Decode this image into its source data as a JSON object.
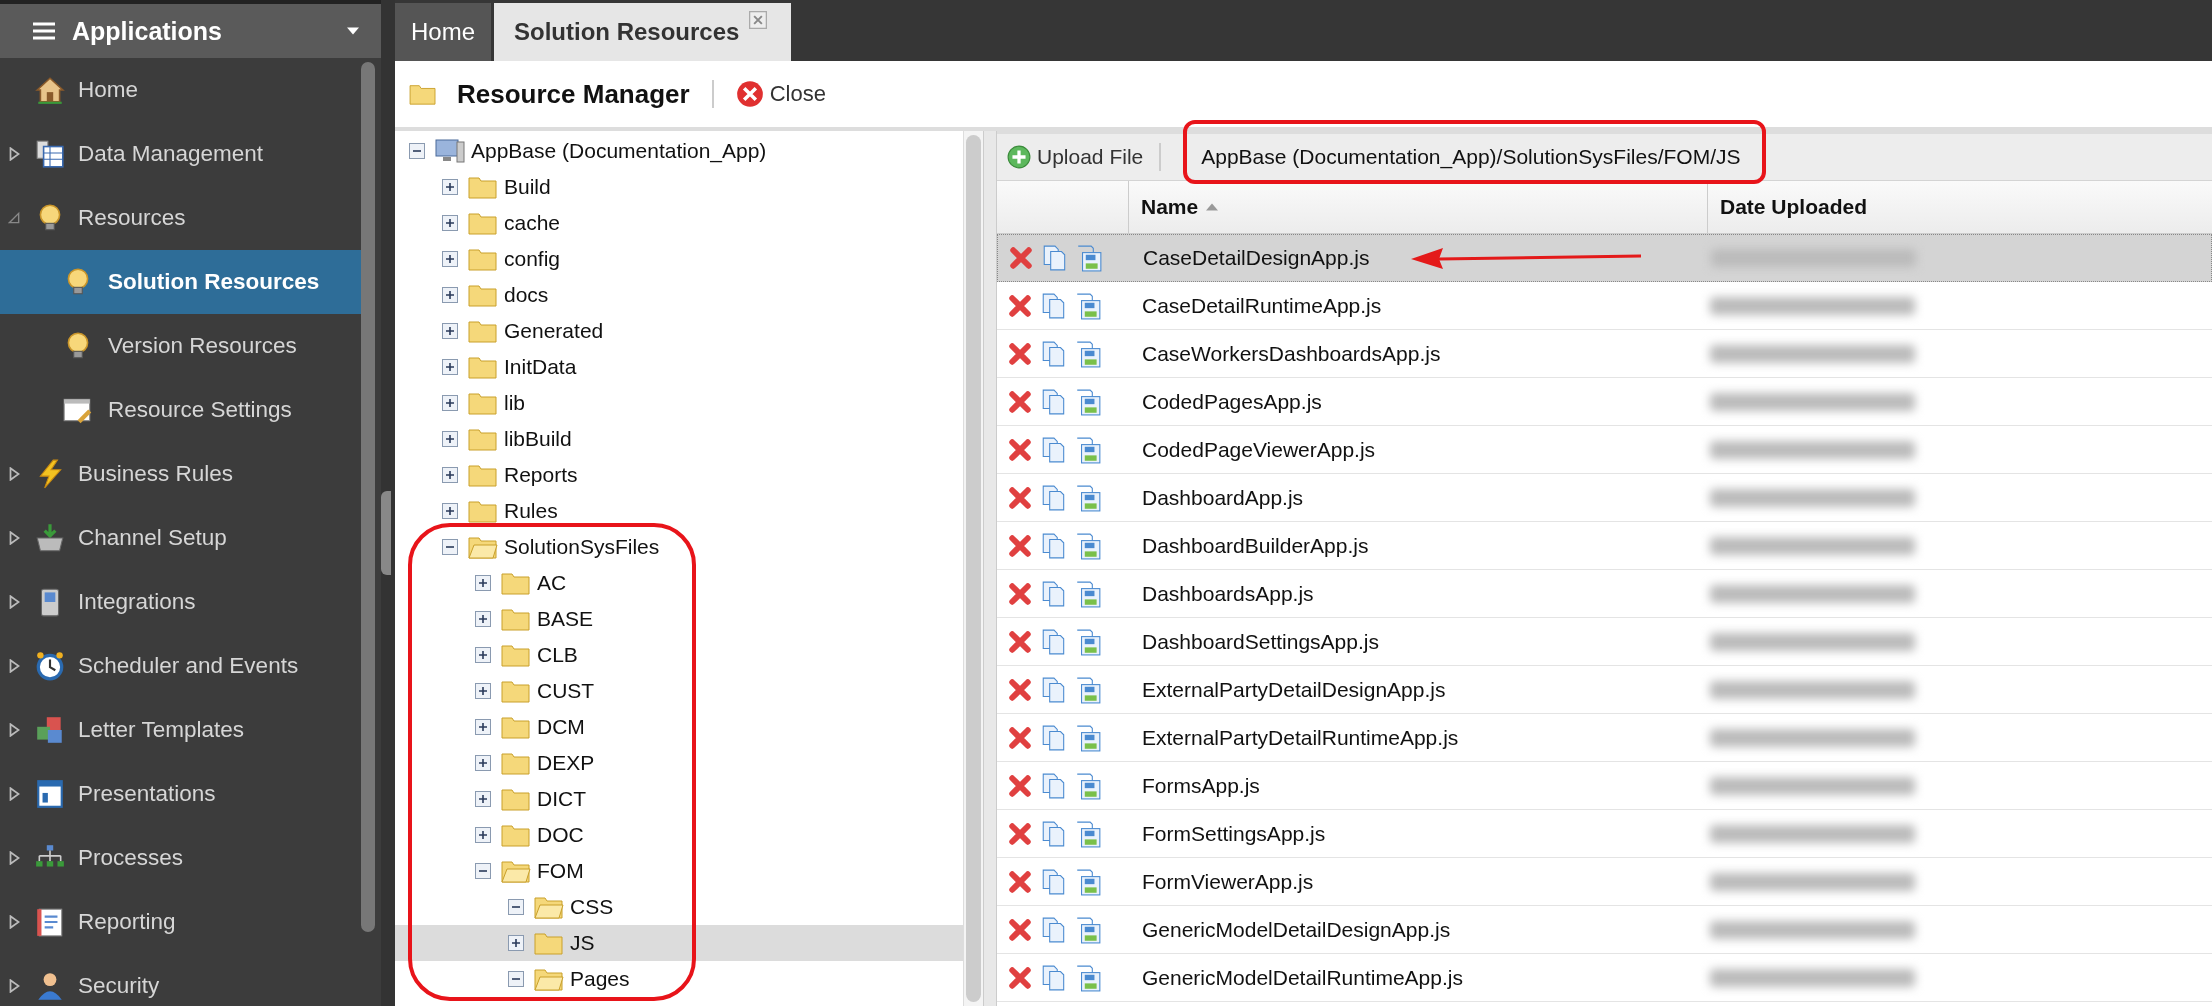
{
  "sidebar": {
    "title": "Applications",
    "items": [
      {
        "label": "Home",
        "kind": "leaf",
        "selected": false
      },
      {
        "label": "Data Management",
        "kind": "group",
        "expanded": false,
        "selected": false
      },
      {
        "label": "Resources",
        "kind": "group",
        "expanded": true,
        "selected": false,
        "children": [
          {
            "label": "Solution Resources",
            "selected": true
          },
          {
            "label": "Version Resources",
            "selected": false
          },
          {
            "label": "Resource Settings",
            "selected": false
          }
        ]
      },
      {
        "label": "Business Rules",
        "kind": "group",
        "expanded": false,
        "selected": false
      },
      {
        "label": "Channel Setup",
        "kind": "group",
        "expanded": false,
        "selected": false
      },
      {
        "label": "Integrations",
        "kind": "group",
        "expanded": false,
        "selected": false
      },
      {
        "label": "Scheduler and Events",
        "kind": "group",
        "expanded": false,
        "selected": false
      },
      {
        "label": "Letter Templates",
        "kind": "group",
        "expanded": false,
        "selected": false
      },
      {
        "label": "Presentations",
        "kind": "group",
        "expanded": false,
        "selected": false
      },
      {
        "label": "Processes",
        "kind": "group",
        "expanded": false,
        "selected": false
      },
      {
        "label": "Reporting",
        "kind": "group",
        "expanded": false,
        "selected": false
      },
      {
        "label": "Security",
        "kind": "group",
        "expanded": false,
        "selected": false
      }
    ]
  },
  "tabs": [
    {
      "label": "Home",
      "selected": false,
      "closable": false
    },
    {
      "label": "Solution Resources",
      "selected": true,
      "closable": true
    }
  ],
  "toolbar": {
    "title": "Resource Manager",
    "close": "Close"
  },
  "tree": [
    {
      "label": "AppBase (Documentation_App)",
      "kind": "computer",
      "expanded": true,
      "selected": false,
      "children": [
        {
          "label": "Build",
          "kind": "folder",
          "expanded": false,
          "selected": false
        },
        {
          "label": "cache",
          "kind": "folder",
          "expanded": false,
          "selected": false
        },
        {
          "label": "config",
          "kind": "folder",
          "expanded": false,
          "selected": false
        },
        {
          "label": "docs",
          "kind": "folder",
          "expanded": false,
          "selected": false
        },
        {
          "label": "Generated",
          "kind": "folder",
          "expanded": false,
          "selected": false
        },
        {
          "label": "InitData",
          "kind": "folder",
          "expanded": false,
          "selected": false
        },
        {
          "label": "lib",
          "kind": "folder",
          "expanded": false,
          "selected": false
        },
        {
          "label": "libBuild",
          "kind": "folder",
          "expanded": false,
          "selected": false
        },
        {
          "label": "Reports",
          "kind": "folder",
          "expanded": false,
          "selected": false
        },
        {
          "label": "Rules",
          "kind": "folder",
          "expanded": false,
          "selected": false
        },
        {
          "label": "SolutionSysFiles",
          "kind": "folder",
          "expanded": true,
          "selected": false,
          "children": [
            {
              "label": "AC",
              "kind": "folder",
              "expanded": false,
              "selected": false
            },
            {
              "label": "BASE",
              "kind": "folder",
              "expanded": false,
              "selected": false
            },
            {
              "label": "CLB",
              "kind": "folder",
              "expanded": false,
              "selected": false
            },
            {
              "label": "CUST",
              "kind": "folder",
              "expanded": false,
              "selected": false
            },
            {
              "label": "DCM",
              "kind": "folder",
              "expanded": false,
              "selected": false
            },
            {
              "label": "DEXP",
              "kind": "folder",
              "expanded": false,
              "selected": false
            },
            {
              "label": "DICT",
              "kind": "folder",
              "expanded": false,
              "selected": false
            },
            {
              "label": "DOC",
              "kind": "folder",
              "expanded": false,
              "selected": false
            },
            {
              "label": "FOM",
              "kind": "folder",
              "expanded": true,
              "selected": false,
              "children": [
                {
                  "label": "CSS",
                  "kind": "folder",
                  "expanded": true,
                  "selected": false
                },
                {
                  "label": "JS",
                  "kind": "folder",
                  "expanded": false,
                  "selected": true
                },
                {
                  "label": "Pages",
                  "kind": "folder",
                  "expanded": true,
                  "selected": false
                }
              ]
            }
          ]
        }
      ]
    }
  ],
  "files": {
    "upload": "Upload File",
    "path": "AppBase (Documentation_App)/SolutionSysFiles/FOM/JS",
    "columns": [
      {
        "label": "Name",
        "sorted": true
      },
      {
        "label": "Date Uploaded",
        "sorted": false
      }
    ],
    "rows": [
      {
        "name": "CaseDetailDesignApp.js",
        "selected": true
      },
      {
        "name": "CaseDetailRuntimeApp.js",
        "selected": false
      },
      {
        "name": "CaseWorkersDashboardsApp.js",
        "selected": false
      },
      {
        "name": "CodedPagesApp.js",
        "selected": false
      },
      {
        "name": "CodedPageViewerApp.js",
        "selected": false
      },
      {
        "name": "DashboardApp.js",
        "selected": false
      },
      {
        "name": "DashboardBuilderApp.js",
        "selected": false
      },
      {
        "name": "DashboardsApp.js",
        "selected": false
      },
      {
        "name": "DashboardSettingsApp.js",
        "selected": false
      },
      {
        "name": "ExternalPartyDetailDesignApp.js",
        "selected": false
      },
      {
        "name": "ExternalPartyDetailRuntimeApp.js",
        "selected": false
      },
      {
        "name": "FormsApp.js",
        "selected": false
      },
      {
        "name": "FormSettingsApp.js",
        "selected": false
      },
      {
        "name": "FormViewerApp.js",
        "selected": false
      },
      {
        "name": "GenericModelDetailDesignApp.js",
        "selected": false
      },
      {
        "name": "GenericModelDetailRuntimeApp.js",
        "selected": false
      }
    ]
  }
}
